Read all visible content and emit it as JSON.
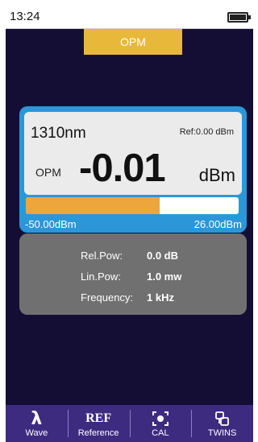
{
  "status": {
    "time": "13:24",
    "battery_icon": "battery-full-icon"
  },
  "mode_tab": "OPM",
  "measurement": {
    "wavelength": "1310nm",
    "reference": "Ref:0.00 dBm",
    "mode": "OPM",
    "value": "-0.01",
    "unit": "dBm",
    "bar_fraction": 0.63,
    "range_min": "-50.00dBm",
    "range_max": "26.00dBm"
  },
  "info": [
    {
      "label": "Rel.Pow:",
      "value": "0.0 dB"
    },
    {
      "label": "Lin.Pow:",
      "value": "1.0 mw"
    },
    {
      "label": "Frequency:",
      "value": "1 kHz"
    }
  ],
  "toolbar": [
    {
      "icon": "lambda-icon",
      "icon_text": "λ",
      "label": "Wave"
    },
    {
      "icon": "ref-icon",
      "icon_text": "REF",
      "label": "Reference"
    },
    {
      "icon": "calibrate-icon",
      "label": "CAL"
    },
    {
      "icon": "twins-icon",
      "label": "TWINS"
    }
  ],
  "colors": {
    "background": "#140e35",
    "accent_yellow": "#e8b83a",
    "panel_blue": "#2b97d8",
    "bar_fill": "#eda63b",
    "info_panel": "#707070",
    "toolbar": "#3d2b80"
  }
}
